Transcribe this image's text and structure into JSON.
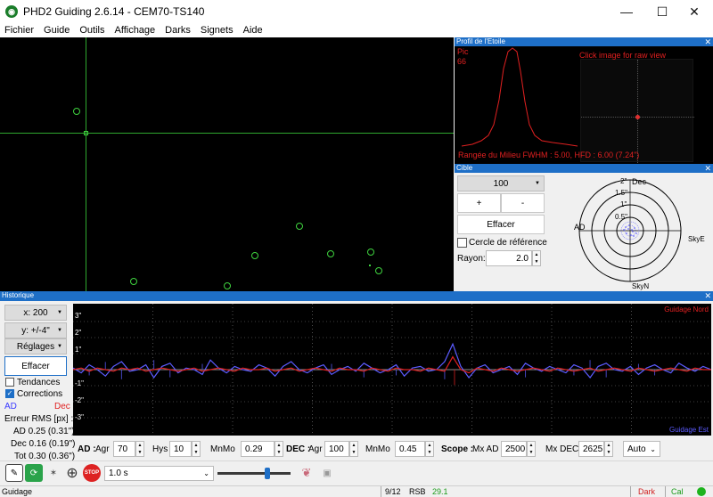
{
  "window": {
    "title": "PHD2 Guiding 2.6.14 - CEM70-TS140",
    "app_icon": "phd2-icon",
    "controls": [
      "minimize-icon",
      "maximize-icon",
      "close-icon"
    ]
  },
  "menu": [
    "Fichier",
    "Guide",
    "Outils",
    "Affichage",
    "Darks",
    "Signets",
    "Aide"
  ],
  "star_profile": {
    "title": "Profil de l'Etoile",
    "peak_label": "Pic",
    "peak_value": "66",
    "click_hint": "Click image for raw view",
    "metrics": "Rangée du Milieu FWHM : 5.00, HFD : 6.00 (7.24\")"
  },
  "target": {
    "title": "Cible",
    "zoom": "100",
    "plus": "+",
    "minus": "-",
    "clear": "Effacer",
    "reference_circle": "Cercle de référence",
    "reference_checked": false,
    "radius_label": "Rayon:",
    "radius_value": "2.0",
    "ring_labels": [
      "2\"",
      "1.5\"",
      "1\"",
      "0.5\""
    ],
    "dec_label": "Dec",
    "ra_label": "AD",
    "east_label": "SkyE",
    "north_label": "SkyN"
  },
  "history": {
    "title": "Historique",
    "x_scale": "x: 200",
    "y_scale": "y: +/-4\"",
    "settings": "Réglages",
    "clear": "Effacer",
    "trends": "Tendances",
    "trends_checked": false,
    "corrections": "Corrections",
    "corrections_checked": true,
    "ra_legend": "AD",
    "dec_legend": "Dec",
    "rms_title": "Erreur RMS [px] :",
    "rms_ra": "AD 0.25 (0.31\")",
    "rms_dec": "Dec 0.16 (0.19\")",
    "rms_tot": "Tot 0.30 (0.36\")",
    "y_axis_labels": [
      "3\"",
      "2\"",
      "1\"",
      "-1\"",
      "-2\"",
      "-3\""
    ],
    "north_label": "Guidage Nord",
    "east_label": "Guidage Est",
    "colors": {
      "ra": "#5b5bff",
      "dec": "#e02020",
      "grid": "#808080"
    }
  },
  "controls": {
    "ra_section": "AD :",
    "agr_label": "Agr",
    "ra_agr": "70",
    "hys_label": "Hys",
    "ra_hys": "10",
    "mnmo_label": "MnMo",
    "ra_mnmo": "0.29",
    "dec_section": "DEC :",
    "dec_agr": "100",
    "dec_mnmo": "0.45",
    "scope_section": "Scope :",
    "mx_ad_label": "Mx AD",
    "mx_ad": "2500",
    "mx_dec_label": "Mx DEC",
    "mx_dec": "2625",
    "mode": "Auto"
  },
  "toolbar": {
    "icons": [
      "brain-pencil-icon",
      "loop-icon",
      "star-select-icon",
      "guide-target-icon",
      "stop-icon",
      "brain-icon",
      "camera-settings-icon"
    ],
    "stop_label": "STOP",
    "exposure": "1.0 s",
    "gamma_level": 0.7
  },
  "status": {
    "state": "Guidage",
    "frames": "9/12",
    "snr_label": "RSB",
    "snr_value": "29.1",
    "dark": "Dark",
    "cal": "Cal"
  },
  "chart_data": {
    "type": "line",
    "ylim": [
      -4,
      4
    ],
    "y_ticks": [
      "3\"",
      "2\"",
      "1\"",
      "-1\"",
      "-2\"",
      "-3\""
    ],
    "series": [
      {
        "name": "AD",
        "values": [
          0.1,
          -0.2,
          0.3,
          0.0,
          -0.4,
          0.2,
          0.5,
          -0.1,
          0.0,
          0.3,
          -0.5,
          0.2,
          0.4,
          -0.2,
          0.1,
          0.0,
          -0.3,
          0.6,
          0.1,
          -0.2,
          0.2,
          0.0,
          -0.1,
          0.3,
          0.1,
          -0.4,
          0.2,
          0.5,
          0.0,
          -0.2,
          0.1,
          0.3,
          -0.3,
          0.0,
          0.2,
          -0.1,
          0.4,
          0.1,
          -0.2,
          0.0,
          0.3,
          -0.4,
          0.1,
          0.2,
          -0.1,
          0.0,
          0.5,
          1.6,
          0.2,
          -0.5,
          0.1,
          0.3,
          -0.2,
          0.0,
          0.2,
          -0.3,
          0.4,
          0.1,
          -0.1,
          0.2,
          0.0,
          -0.2,
          0.3,
          0.1,
          -0.5,
          0.2,
          0.4,
          0.0,
          -0.1,
          0.2,
          -0.3,
          0.1,
          0.3,
          0.0,
          -0.2,
          0.4,
          0.1,
          -0.1,
          0.2,
          0.0
        ]
      },
      {
        "name": "Dec",
        "values": [
          0.0,
          0.1,
          -0.1,
          0.1,
          0.0,
          -0.1,
          0.1,
          0.0,
          0.1,
          -0.1,
          0.0,
          0.1,
          0.0,
          -0.1,
          0.0,
          0.1,
          -0.1,
          0.0,
          0.1,
          0.0,
          -0.1,
          0.1,
          0.0,
          0.0,
          0.1,
          -0.1,
          0.0,
          0.1,
          -0.1,
          0.0,
          0.1,
          0.0,
          -0.1,
          0.1,
          0.0,
          0.0,
          -0.1,
          0.1,
          0.0,
          -0.1,
          0.1,
          0.0,
          0.0,
          -0.1,
          0.1,
          0.0,
          -0.1,
          0.8,
          0.0,
          -0.2,
          0.1,
          0.0,
          -0.1,
          0.1,
          0.0,
          -0.1,
          0.0,
          0.1,
          0.0,
          -0.1,
          0.1,
          0.0,
          -0.1,
          0.0,
          0.1,
          -0.1,
          0.0,
          0.1,
          0.0,
          -0.1,
          0.1,
          0.0,
          -0.1,
          0.0,
          0.1,
          0.0,
          -0.1,
          0.1,
          0.0,
          0.0
        ]
      }
    ]
  }
}
